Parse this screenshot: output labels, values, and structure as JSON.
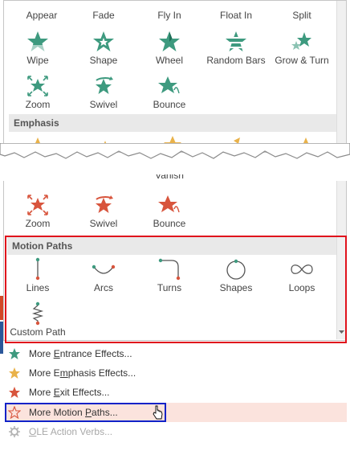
{
  "top_row_labels": [
    "Appear",
    "Fade",
    "Fly In",
    "Float In",
    "Split"
  ],
  "entrance": [
    {
      "label": "Wipe",
      "icon": "wipe-star-icon"
    },
    {
      "label": "Shape",
      "icon": "shape-star-icon"
    },
    {
      "label": "Wheel",
      "icon": "wheel-star-icon"
    },
    {
      "label": "Random Bars",
      "icon": "random-bars-star-icon"
    },
    {
      "label": "Grow & Turn",
      "icon": "grow-turn-star-icon"
    },
    {
      "label": "Zoom",
      "icon": "zoom-star-icon"
    },
    {
      "label": "Swivel",
      "icon": "swivel-star-icon"
    },
    {
      "label": "Bounce",
      "icon": "bounce-star-icon"
    }
  ],
  "emphasis_header": "Emphasis",
  "exit_partial_label": "Vanish",
  "exit": [
    {
      "label": "Zoom",
      "icon": "zoom-star-icon"
    },
    {
      "label": "Swivel",
      "icon": "swivel-star-icon"
    },
    {
      "label": "Bounce",
      "icon": "bounce-star-icon"
    }
  ],
  "motion_header": "Motion Paths",
  "motion": [
    {
      "label": "Lines",
      "icon": "lines-path-icon"
    },
    {
      "label": "Arcs",
      "icon": "arcs-path-icon"
    },
    {
      "label": "Turns",
      "icon": "turns-path-icon"
    },
    {
      "label": "Shapes",
      "icon": "shapes-path-icon"
    },
    {
      "label": "Loops",
      "icon": "loops-path-icon"
    },
    {
      "label": "Custom Path",
      "icon": "custom-path-icon"
    }
  ],
  "menu": [
    {
      "pre": "More ",
      "u": "E",
      "post": "ntrance Effects...",
      "icon": "green-star-icon"
    },
    {
      "pre": "More E",
      "u": "m",
      "post": "phasis Effects...",
      "icon": "gold-star-icon"
    },
    {
      "pre": "More ",
      "u": "E",
      "post": "xit Effects...",
      "icon": "red-star-icon"
    },
    {
      "pre": "More Motion ",
      "u": "P",
      "post": "aths...",
      "icon": "outline-star-icon"
    },
    {
      "pre": "",
      "u": "O",
      "post": "LE Action Verbs...",
      "icon": "gear-icon"
    }
  ],
  "colors": {
    "entrance": "#3e9a7f",
    "emphasis": "#e9b24a",
    "exit": "#d8553d",
    "highlight": "#fbe3dd",
    "red_box": "#e0121c",
    "blue_box": "#1122c8"
  }
}
